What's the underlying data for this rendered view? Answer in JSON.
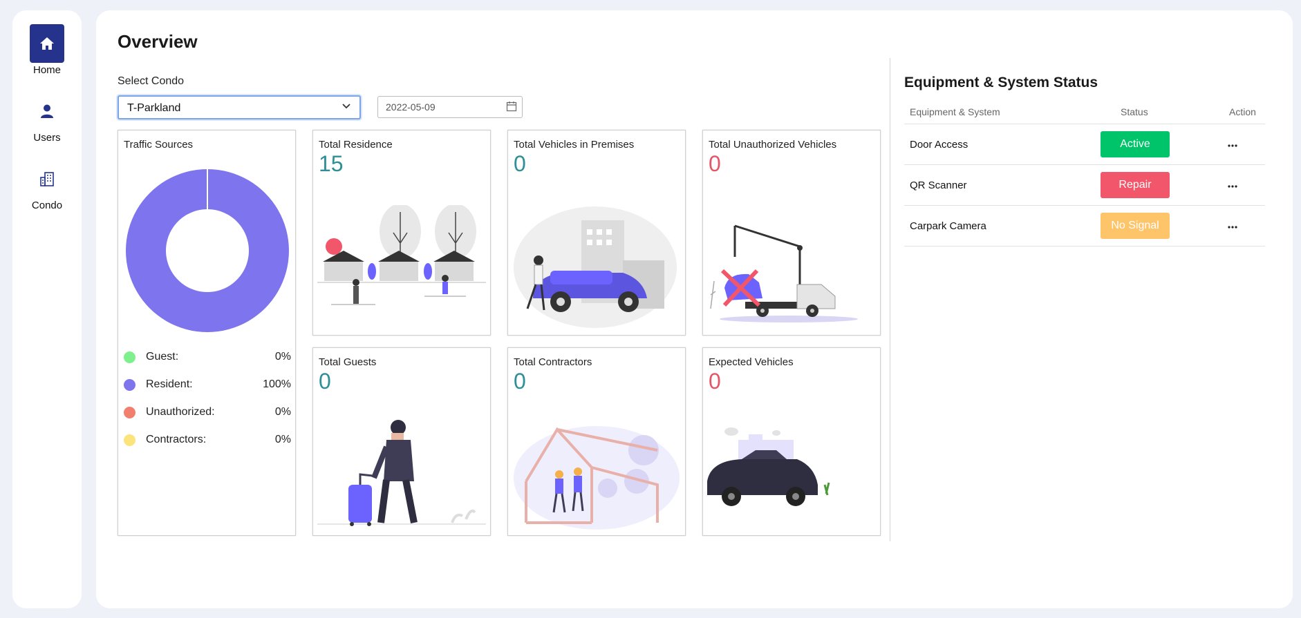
{
  "sidebar": {
    "items": [
      {
        "label": "Home",
        "icon": "home-icon",
        "active": true
      },
      {
        "label": "Users",
        "icon": "user-icon",
        "active": false
      },
      {
        "label": "Condo",
        "icon": "building-icon",
        "active": false
      }
    ]
  },
  "page": {
    "title": "Overview"
  },
  "filters": {
    "condo_label": "Select Condo",
    "condo_value": "T-Parkland",
    "date_value": "2022-05-09"
  },
  "traffic": {
    "title": "Traffic Sources",
    "legend": [
      {
        "name": "Guest:",
        "value": "0%",
        "color": "#7ef08c"
      },
      {
        "name": "Resident:",
        "value": "100%",
        "color": "#7d74ee"
      },
      {
        "name": "Unauthorized:",
        "value": "0%",
        "color": "#f27f6e"
      },
      {
        "name": "Contractors:",
        "value": "0%",
        "color": "#fbe47b"
      }
    ]
  },
  "chart_data": {
    "type": "pie",
    "title": "Traffic Sources",
    "categories": [
      "Guest",
      "Resident",
      "Unauthorized",
      "Contractors"
    ],
    "values": [
      0,
      100,
      0,
      0
    ],
    "unit": "%",
    "donut": true,
    "colors": [
      "#7ef08c",
      "#7d74ee",
      "#f27f6e",
      "#fbe47b"
    ]
  },
  "stats": {
    "total_residence": {
      "title": "Total Residence",
      "value": "15"
    },
    "total_vehicles": {
      "title": "Total Vehicles in Premises",
      "value": "0"
    },
    "total_unauthorized": {
      "title": "Total Unauthorized Vehicles",
      "value": "0"
    },
    "total_guests": {
      "title": "Total Guests",
      "value": "0"
    },
    "total_contractors": {
      "title": "Total Contractors",
      "value": "0"
    },
    "expected_vehicles": {
      "title": "Expected Vehicles",
      "value": "0"
    }
  },
  "equipment": {
    "title": "Equipment & System Status",
    "columns": [
      "Equipment & System",
      "Status",
      "Action"
    ],
    "rows": [
      {
        "name": "Door Access",
        "status": "Active",
        "color": "#00c46a"
      },
      {
        "name": "QR Scanner",
        "status": "Repair",
        "color": "#f2566a"
      },
      {
        "name": "Carpark Camera",
        "status": "No Signal",
        "color": "#fdc46a"
      }
    ]
  },
  "colors": {
    "accent": "#25338c",
    "teal_value": "#2f8f96",
    "red_value": "#e45769"
  }
}
